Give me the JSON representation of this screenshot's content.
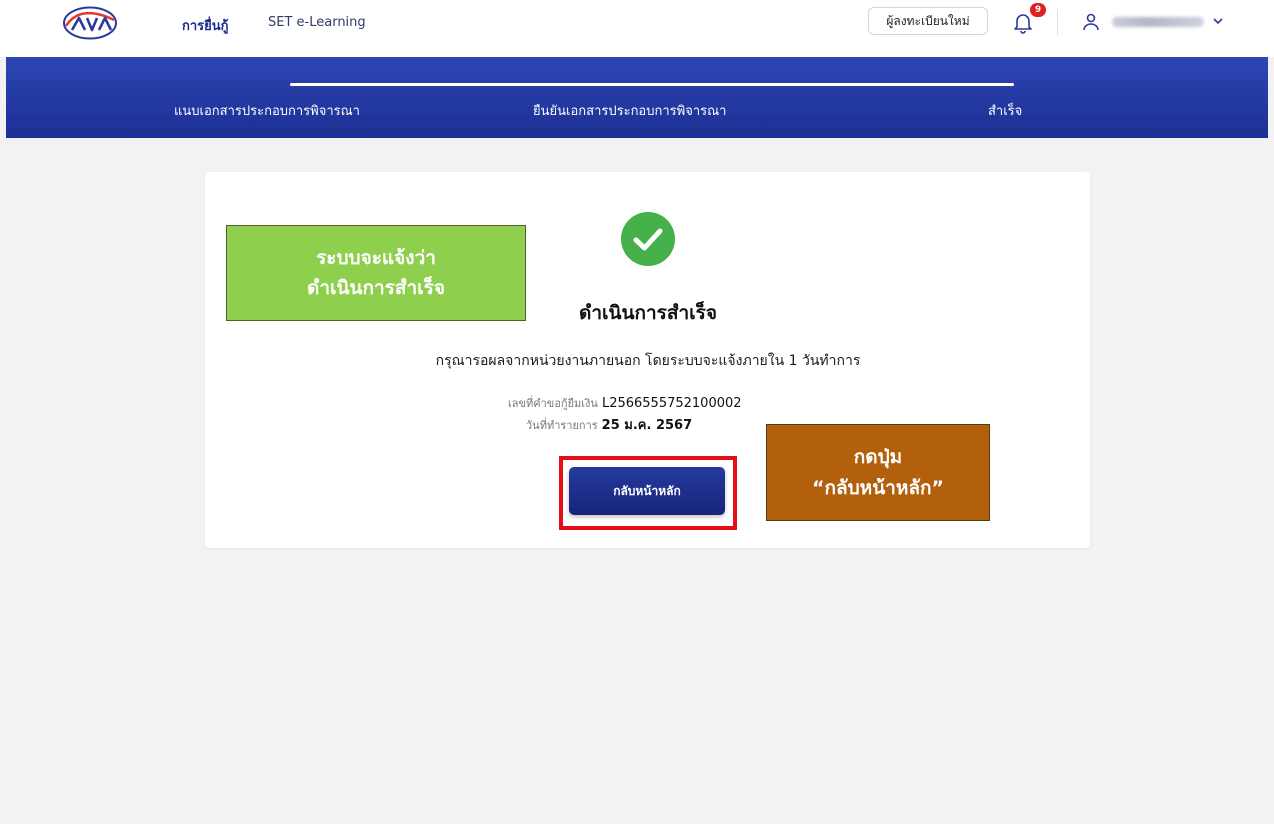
{
  "topnav": {
    "links": [
      "การยื่นกู้",
      "SET e-Learning"
    ],
    "register_label": "ผู้ลงทะเบียนใหม่",
    "notification_count": "9"
  },
  "stepper": {
    "steps": [
      "แนบเอกสารประกอบการพิจารณา",
      "ยืนยันเอกสารประกอบการพิจารณา",
      "สำเร็จ"
    ],
    "current_step": 3
  },
  "result": {
    "title": "ดำเนินการสำเร็จ",
    "description": "กรุณารอผลจากหน่วยงานภายนอก โดยระบบจะแจ้งภายใน 1 วันทำการ",
    "loan_label": "เลขที่คำขอกู้ยืมเงิน",
    "loan_number": "L2566555752100002",
    "date_label": "วันที่ทำรายการ",
    "date_value": "25 ม.ค. 2567",
    "home_button": "กลับหน้าหลัก"
  },
  "annotations": {
    "green_line1": "ระบบจะแจ้งว่า",
    "green_line2": "ดำเนินการสำเร็จ",
    "brown_line1": "กดปุ่ม",
    "brown_line2": "“กลับหน้าหลัก”"
  },
  "colors": {
    "brand_blue": "#1c2f95",
    "success_green": "#46b04a",
    "badge_red": "#e0201f",
    "highlight_red": "#e50f17"
  }
}
